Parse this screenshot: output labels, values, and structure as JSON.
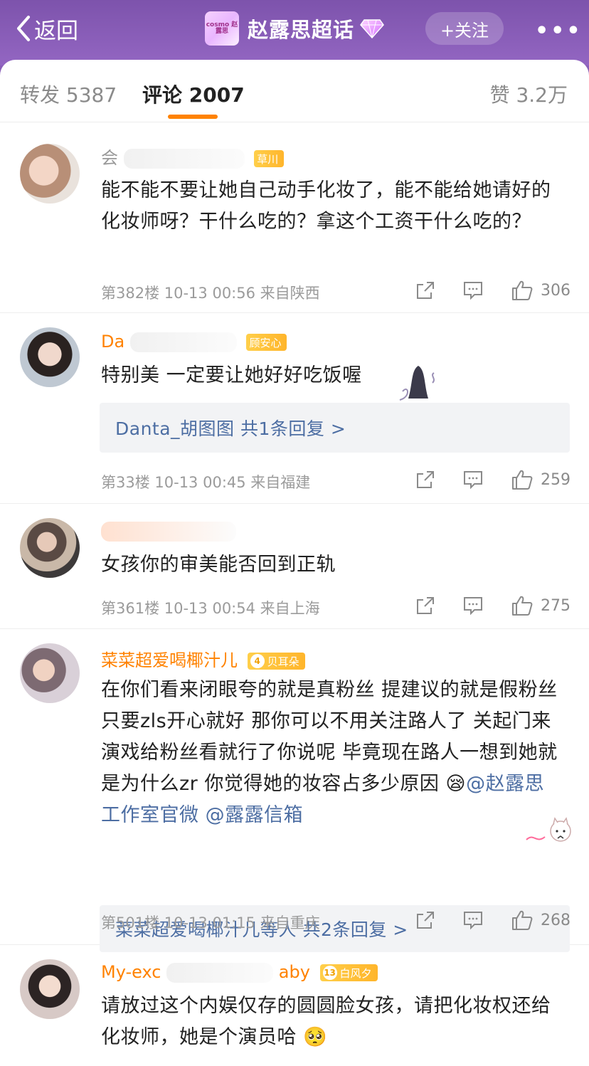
{
  "header": {
    "back_label": "返回",
    "topic_name": "赵露思超话",
    "topic_thumb_text": "cosmo 赵露思",
    "follow_label": "+关注",
    "more": "•••"
  },
  "tabs": {
    "repost": "转发 5387",
    "comments": "评论 2007",
    "likes": "赞 3.2万"
  },
  "comments": [
    {
      "username": "会",
      "username_tail": "",
      "badge_level": "",
      "badge_text": "草川",
      "text": "能不能不要让她自己动手化妆了，能不能给她请好的化妆师呀？干什么吃的？拿这个工资干什么吃的？",
      "meta": "第382楼 10-13 00:56 来自陕西",
      "likes": "306"
    },
    {
      "username": "Da",
      "badge_level": "",
      "badge_text": "顾安心",
      "text": "特别美 一定要让她好好吃饭喔",
      "reply_summary": "Danta_胡图图 共1条回复 >",
      "meta": "第33楼 10-13 00:45 来自福建",
      "likes": "259"
    },
    {
      "username": "",
      "badge_level": "",
      "badge_text": "",
      "text": "女孩你的审美能否回到正轨",
      "meta": "第361楼 10-13 00:54 来自上海",
      "likes": "275"
    },
    {
      "username": "菜菜超爱喝椰汁儿",
      "badge_level": "4",
      "badge_text": "贝耳朵",
      "text_parts": [
        "在你们看来闭眼夸的就是真粉丝 提建议的就是假粉丝 只要zls开心就好 那你可以不用关注路人了 关起门来演戏给粉丝看就行了你说呢 毕竟现在路人一想到她就是为什么zr 你觉得她的妆容占多少原因 😪",
        "@赵露思工作室官微",
        " ",
        "@露露信箱"
      ],
      "reply_summary": "菜菜超爱喝椰汁儿等人 共2条回复 >",
      "meta": "第501楼 10-13 01:15 来自重庆",
      "likes": "268"
    },
    {
      "username": "My-exc",
      "username_tail": "aby",
      "badge_level": "13",
      "badge_text": "白风夕",
      "text": "请放过这个内娱仅存的圆圆脸女孩，请把化妆权还给化妆师，她是个演员哈 🥺"
    }
  ],
  "colors": {
    "header_purple": "#8a5fb8",
    "accent_orange": "#ff8200",
    "link_blue": "#4d6ea3",
    "meta_gray": "#9b9b9b"
  },
  "icons": [
    "chevron-left-icon",
    "gem-icon",
    "share-icon",
    "comment-icon",
    "thumbs-up-icon"
  ]
}
